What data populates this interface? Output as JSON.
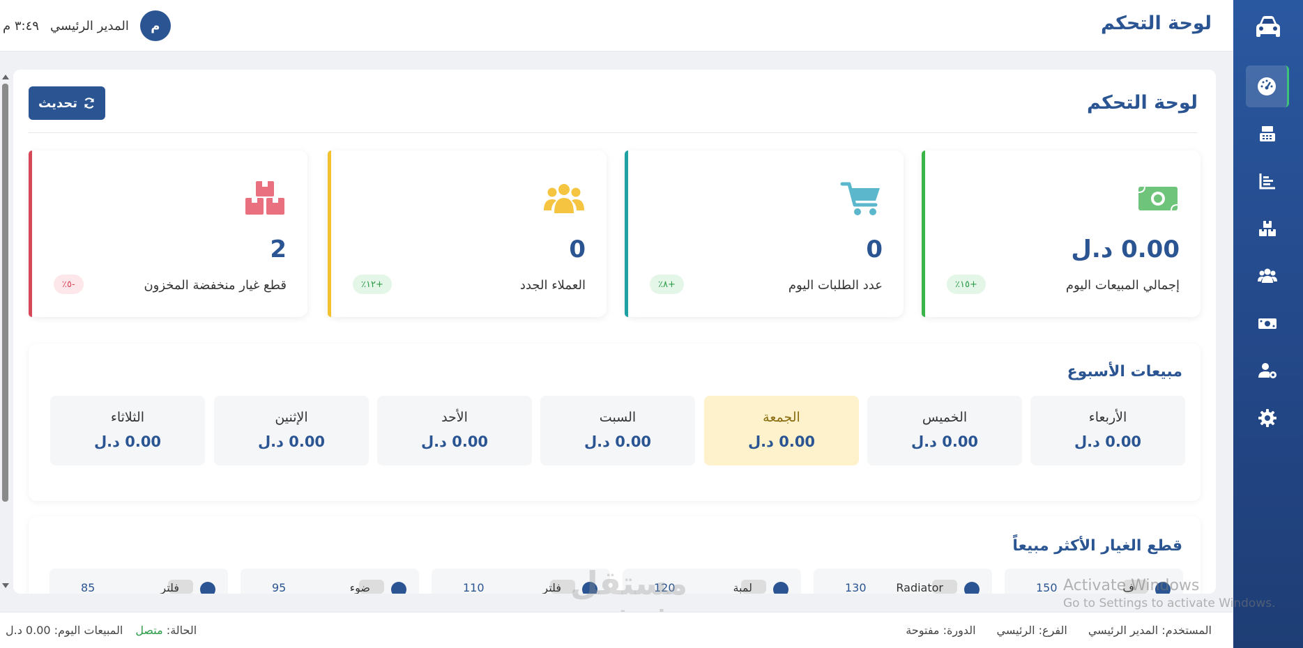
{
  "colors": {
    "primary": "#2a5592",
    "sidebar": "#24498a",
    "green": "#3bb54a",
    "teal": "#1fa0a3",
    "yellow": "#f2c22e",
    "red": "#d64858"
  },
  "sidebar": {
    "logo_icon": "car-icon",
    "items": [
      {
        "icon": "dashboard-icon",
        "active": true
      },
      {
        "icon": "cash-register-icon",
        "active": false
      },
      {
        "icon": "chart-icon",
        "active": false
      },
      {
        "icon": "boxes-icon",
        "active": false
      },
      {
        "icon": "users-icon",
        "active": false
      },
      {
        "icon": "money-icon",
        "active": false
      },
      {
        "icon": "user-settings-icon",
        "active": false
      },
      {
        "icon": "gear-icon",
        "active": false
      }
    ]
  },
  "header": {
    "title": "لوحة التحكم",
    "user_name": "المدير الرئيسي",
    "avatar_initial": "م",
    "clock": "٣:٤٩ م"
  },
  "main": {
    "title": "لوحة التحكم",
    "refresh_label": "تحديث"
  },
  "stats": [
    {
      "label": "إجمالي المبيعات اليوم",
      "value": "0.00 د.ل",
      "badge": "+١٥٪",
      "icon": "money-bill-icon"
    },
    {
      "label": "عدد الطلبات اليوم",
      "value": "0",
      "badge": "+٨٪",
      "icon": "cart-icon"
    },
    {
      "label": "العملاء الجدد",
      "value": "0",
      "badge": "+١٢٪",
      "icon": "users-icon"
    },
    {
      "label": "قطع غيار منخفضة المخزون",
      "value": "2",
      "badge": "-٥٪",
      "icon": "boxes-icon"
    }
  ],
  "weekly": {
    "title": "مبيعات الأسبوع",
    "days": [
      {
        "name": "الأربعاء",
        "value": "0.00 د.ل"
      },
      {
        "name": "الخميس",
        "value": "0.00 د.ل"
      },
      {
        "name": "الجمعة",
        "value": "0.00 د.ل",
        "today": true
      },
      {
        "name": "السبت",
        "value": "0.00 د.ل"
      },
      {
        "name": "الأحد",
        "value": "0.00 د.ل"
      },
      {
        "name": "الإثنين",
        "value": "0.00 د.ل"
      },
      {
        "name": "الثلاثاء",
        "value": "0.00 د.ل"
      }
    ]
  },
  "top_parts": {
    "title": "قطع الغيار الأكثر مبيعاً",
    "items": [
      {
        "name": "ف",
        "count": "150"
      },
      {
        "name": "Radiator",
        "count": "130"
      },
      {
        "name": "لمبة",
        "count": "120"
      },
      {
        "name": "فلتر",
        "count": "110"
      },
      {
        "name": "ضوء",
        "count": "95"
      },
      {
        "name": "فلتر",
        "count": "85"
      }
    ]
  },
  "footer": {
    "user": "المستخدم: المدير الرئيسي",
    "branch": "الفرع: الرئيسي",
    "session": "الدورة: مفتوحة",
    "status_label": "الحالة:",
    "status_value": "متصل",
    "today_sales": "المبيعات اليوم: 0.00 د.ل"
  },
  "watermark": {
    "activate_title": "Activate Windows",
    "activate_sub": "Go to Settings to activate Windows.",
    "brand": "مستقل",
    "brand_latin": "mostaql.com"
  }
}
